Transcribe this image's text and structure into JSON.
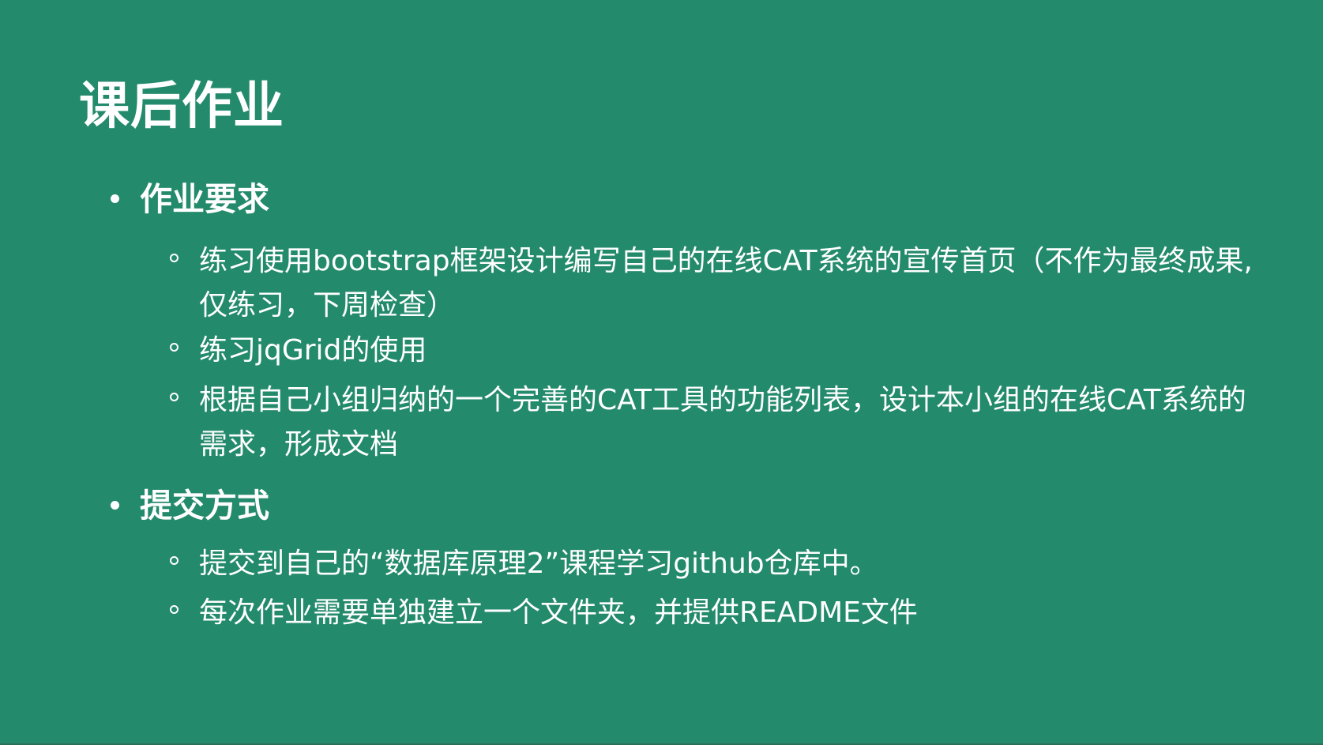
{
  "slide": {
    "background_color": "#238a6c",
    "title": "课后作业",
    "sections": [
      {
        "heading": "作业要求",
        "items": [
          "练习使用bootstrap框架设计编写自己的在线CAT系统的宣传首页（不作为最终成果,仅练习，下周检查）",
          "练习jqGrid的使用",
          "根据自己小组归纳的一个完善的CAT工具的功能列表，设计本小组的在线CAT系统的需求，形成文档"
        ]
      },
      {
        "heading": "提交方式",
        "items": [
          "提交到自己的“数据库原理2”课程学习github仓库中。",
          "每次作业需要单独建立一个文件夹，并提供README文件"
        ]
      }
    ]
  }
}
